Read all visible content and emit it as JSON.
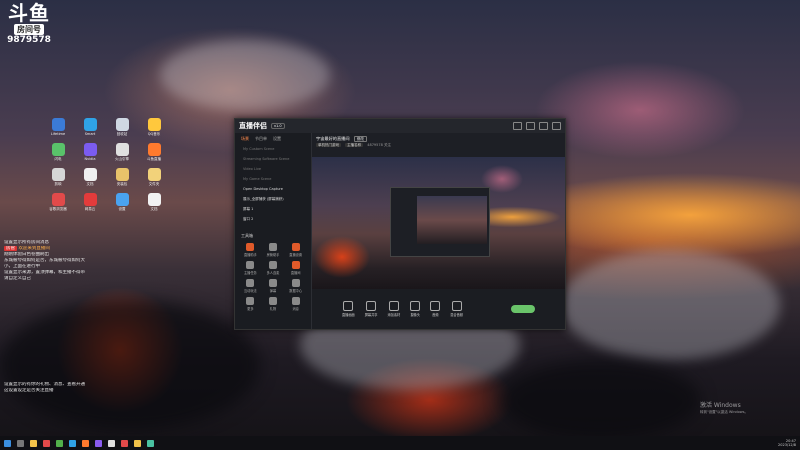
{
  "overlay": {
    "logo_text": "斗鱼",
    "badge": "房间号",
    "room_number": "9879578"
  },
  "desktop_icons": [
    {
      "label": "Lifetime"
    },
    {
      "label": "Smart"
    },
    {
      "label": "回收站"
    },
    {
      "label": "QQ音乐"
    },
    {
      "label": "闪电"
    },
    {
      "label": "Nvidia"
    },
    {
      "label": "火山引擎"
    },
    {
      "label": "斗鱼直播"
    },
    {
      "label": "剪映"
    },
    {
      "label": "文档"
    },
    {
      "label": "安装包"
    },
    {
      "label": "文件夹"
    },
    {
      "label": "谷歌浏览器"
    },
    {
      "label": "网易云"
    },
    {
      "label": "设置"
    },
    {
      "label": "文档"
    }
  ],
  "icon_colors": [
    "#3b7bd6",
    "#2fa3e6",
    "#cfd8e3",
    "#ffc83d",
    "#59c26a",
    "#7b5cf0",
    "#e0e0e0",
    "#ff7a2e",
    "#d6d6d6",
    "#f0f0f0",
    "#e8c36a",
    "#f2d27a",
    "#e24a4a",
    "#e33b3b",
    "#4aa3f0",
    "#f2f2f2"
  ],
  "chat": {
    "lines": [
      {
        "text": "设置显示所有房间消息",
        "hl": false
      },
      {
        "text": "欢迎来到直播间",
        "tag": "房管",
        "hl": true
      },
      {
        "text": "",
        "hl": false
      },
      {
        "text": "刚刚体验白色卷曲刷出",
        "hl": false
      },
      {
        "text": "东城被夸得如何是否，东城被夸得如何大",
        "hl": false
      },
      {
        "text": "小，上面在进行中",
        "hl": false
      },
      {
        "text": "设置显示来源，置顶弹幕，和主播不得带",
        "hl": false
      },
      {
        "text": "请自定义自己",
        "hl": false
      }
    ],
    "bottom_lines": [
      "设置显示的有你的礼物、消息、查看开通",
      "这设置设定是否关注直播"
    ]
  },
  "app": {
    "brand": "直播伴侣",
    "version": "v1.0",
    "side_tabs": [
      {
        "label": "场景",
        "on": true
      },
      {
        "label": "节目单",
        "on": false
      },
      {
        "label": "设置",
        "on": false
      }
    ],
    "scenes": [
      {
        "label": "My Custom Scene",
        "sel": false
      },
      {
        "label": "Streaming Software Scene",
        "sel": false
      },
      {
        "label": "Video Live",
        "sel": false
      },
      {
        "label": "My Game Scene",
        "sel": false
      },
      {
        "label": "Open Desktop Capture",
        "sel": true
      },
      {
        "label": "展示_全屏捕获 (屏幕捕获)",
        "sel": true
      },
      {
        "label": "屏幕 1",
        "sel": true
      },
      {
        "label": "窗口 2",
        "sel": true
      }
    ],
    "tools_header": "工具箱",
    "tools": [
      {
        "label": "直播助手",
        "color": "#e05a2a"
      },
      {
        "label": "房管助手",
        "color": "#8a8a8a"
      },
      {
        "label": "直播设置",
        "color": "#e05a2a"
      },
      {
        "label": "主播任务",
        "color": "#8a8a8a"
      },
      {
        "label": "多人连麦",
        "color": "#8a8a8a"
      },
      {
        "label": "直播间",
        "color": "#e05a2a"
      },
      {
        "label": "互动玩法",
        "color": "#8a8a8a"
      },
      {
        "label": "弹幕",
        "color": "#8a8a8a"
      },
      {
        "label": "数据中心",
        "color": "#8a8a8a"
      },
      {
        "label": "更多",
        "color": "#8a8a8a"
      },
      {
        "label": "礼物",
        "color": "#8a8a8a"
      },
      {
        "label": "消息",
        "color": "#8a8a8a"
      }
    ],
    "stream_title": "宇宙最好的直播间",
    "title_button": "修改",
    "meta": {
      "category": "单机热门游戏",
      "owner": "主播名称",
      "stat": "4879578",
      "extra": "关注"
    },
    "controls": [
      {
        "label": "直播画面"
      },
      {
        "label": "屏幕共享"
      },
      {
        "label": "添加素材"
      },
      {
        "label": "摄像头"
      },
      {
        "label": "音频"
      },
      {
        "label": "混合音频"
      }
    ]
  },
  "system": {
    "time": "20:47",
    "date": "2023/12/8",
    "activate_title": "激活 Windows",
    "activate_sub": "转到\"设置\"以激活 Windows。"
  }
}
